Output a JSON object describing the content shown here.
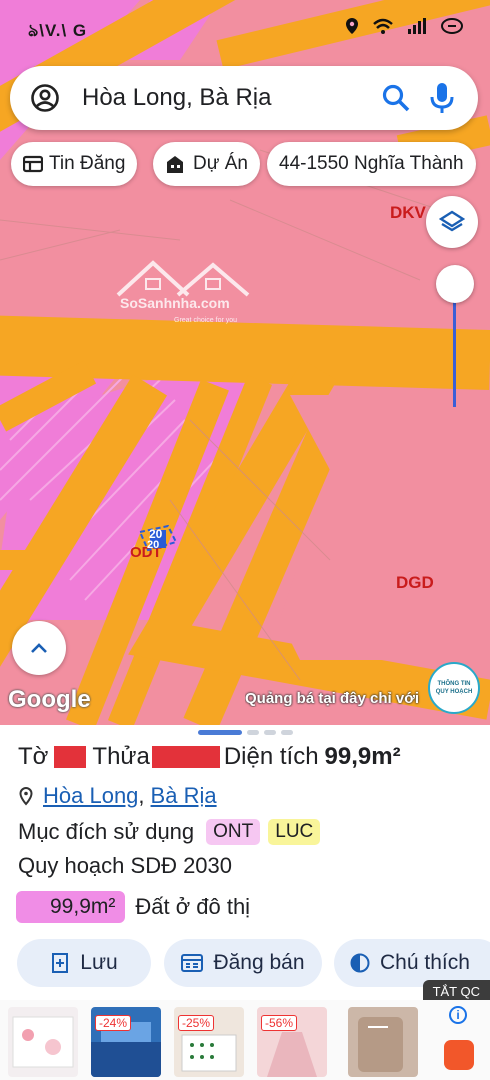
{
  "status_bar": {
    "left_text": "ঌ\\V.\\ G",
    "icons": [
      "location-icon",
      "wifi-icon",
      "signal-icon",
      "battery-icon"
    ]
  },
  "search": {
    "value": "Hòa Long, Bà Rịa",
    "placeholder": ""
  },
  "chips": [
    {
      "label": "Tin Đăng",
      "icon": "listing-icon"
    },
    {
      "label": "Dự Án",
      "icon": "building-icon"
    },
    {
      "label": "44-1550 Nghĩa Thành"
    }
  ],
  "map": {
    "zone_labels": [
      "DKV",
      "DGD",
      "ODT"
    ],
    "parcel_numbers": [
      "20",
      "20"
    ],
    "watermark": {
      "brand": "SoSanhnha.com",
      "tagline": "Great choice for you"
    },
    "google_logo": "Google",
    "ad_text": "Quảng bá tại đây chỉ với",
    "info_logo": [
      "THÔNG TIN",
      "QUY HOẠCH"
    ]
  },
  "parcel": {
    "to_label": "Tờ",
    "thua_label": "Thửa",
    "area_label": "Diện tích",
    "area_value": "99,9m²",
    "location": {
      "ward": "Hòa Long",
      "city": "Bà Rịa",
      "separator": ","
    },
    "purpose_label": "Mục đích sử dụng",
    "purpose_tags": [
      "ONT",
      "LUC"
    ],
    "plan_label": "Quy hoạch SDĐ 2030",
    "plan_area": "99,9m²",
    "plan_desc": "Đất ở đô thị"
  },
  "actions": {
    "save": "Lưu",
    "post": "Đăng bán",
    "legend": "Chú thích"
  },
  "ads": {
    "close_label": "TẮT QC",
    "badges": [
      "-24%",
      "-25%",
      "-56%"
    ]
  },
  "colors": {
    "map_base": "#f2889b",
    "road": "#f6a623",
    "residential": "#f07dd8",
    "accent": "#1a5fb4"
  }
}
